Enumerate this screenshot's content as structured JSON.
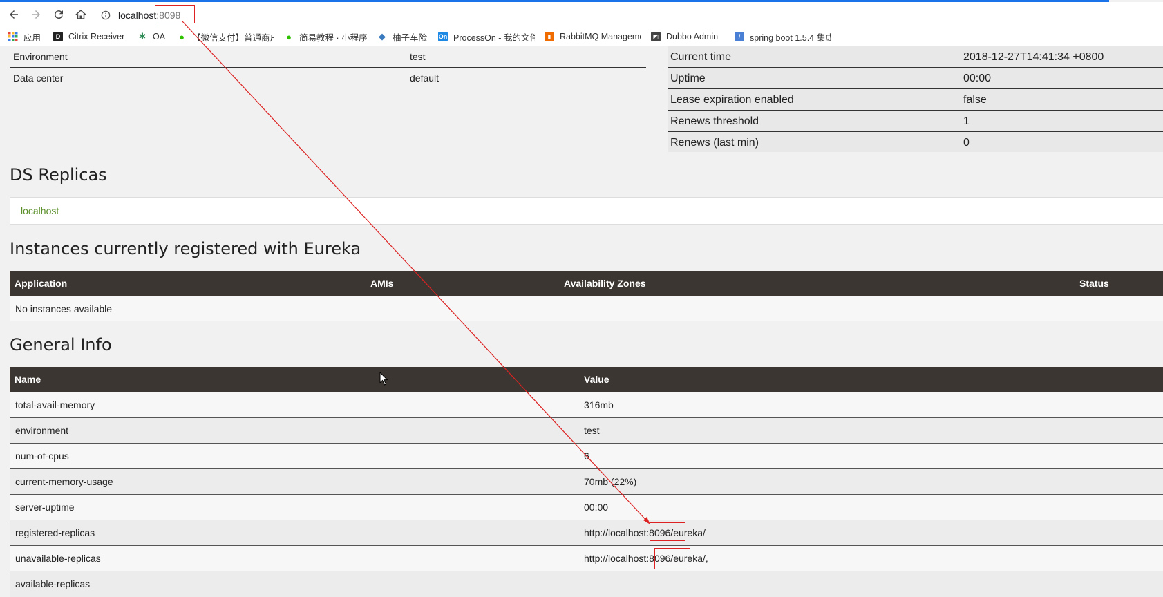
{
  "browser": {
    "url_host": "localhost",
    "url_port": ":8098",
    "bookmarks": [
      {
        "label": "应用",
        "icon": "apps-grid-icon",
        "color": "#e8453c"
      },
      {
        "label": "Citrix Receiver",
        "icon": "citrix-icon",
        "color": "#222222"
      },
      {
        "label": "OA",
        "icon": "oa-gear-icon",
        "color": "#2e8b57"
      },
      {
        "label": "【微信支付】普通商户",
        "icon": "wechat-icon",
        "color": "#2dc100"
      },
      {
        "label": "简易教程 · 小程序",
        "icon": "wechat-icon",
        "color": "#2dc100"
      },
      {
        "label": "柚子车险",
        "icon": "diamond-icon",
        "color": "#3a7bbf"
      },
      {
        "label": "ProcessOn - 我的文件",
        "icon": "processon-icon",
        "color": "#1e88e5"
      },
      {
        "label": "RabbitMQ Management",
        "icon": "rabbitmq-icon",
        "color": "#f06c00"
      },
      {
        "label": "Dubbo Admin",
        "icon": "dubbo-icon",
        "color": "#444444"
      },
      {
        "label": "spring boot 1.5.4 集成",
        "icon": "bookmark-doc-icon",
        "color": "#4a7fd6"
      }
    ]
  },
  "system_status_left": [
    {
      "name": "Environment",
      "value": "test"
    },
    {
      "name": "Data center",
      "value": "default"
    }
  ],
  "system_status_right": [
    {
      "name": "Current time",
      "value": "2018-12-27T14:41:34 +0800"
    },
    {
      "name": "Uptime",
      "value": "00:00"
    },
    {
      "name": "Lease expiration enabled",
      "value": "false"
    },
    {
      "name": "Renews threshold",
      "value": "1"
    },
    {
      "name": "Renews (last min)",
      "value": "0"
    }
  ],
  "ds_replicas": {
    "title": "DS Replicas",
    "link": "localhost"
  },
  "instances": {
    "title": "Instances currently registered with Eureka",
    "columns": [
      "Application",
      "AMIs",
      "Availability Zones",
      "Status"
    ],
    "empty_text": "No instances available"
  },
  "general_info": {
    "title": "General Info",
    "columns": [
      "Name",
      "Value"
    ],
    "rows": [
      {
        "name": "total-avail-memory",
        "value": "316mb"
      },
      {
        "name": "environment",
        "value": "test"
      },
      {
        "name": "num-of-cpus",
        "value": "6"
      },
      {
        "name": "current-memory-usage",
        "value": "70mb (22%)"
      },
      {
        "name": "server-uptime",
        "value": "00:00"
      },
      {
        "name": "registered-replicas",
        "value": "http://localhost:8096/eureka/"
      },
      {
        "name": "unavailable-replicas",
        "value": "http://localhost:8096/eureka/,"
      },
      {
        "name": "available-replicas",
        "value": ""
      }
    ]
  },
  "annotation_color": "#dd2222"
}
